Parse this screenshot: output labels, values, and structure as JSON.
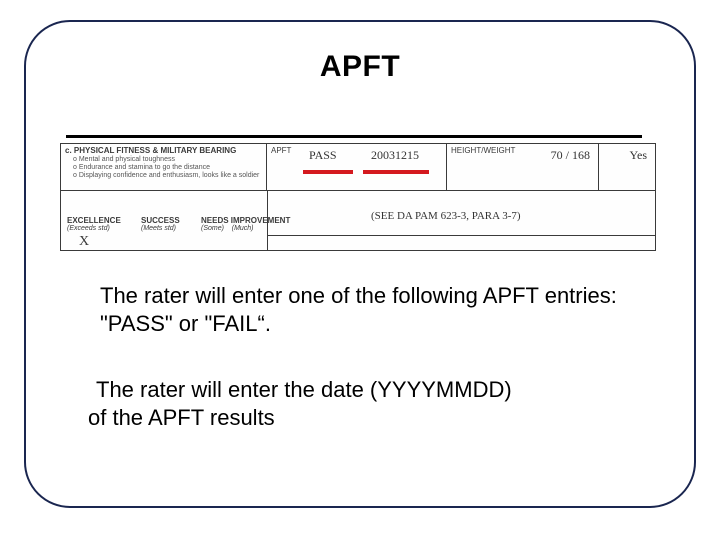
{
  "title": "APFT",
  "form": {
    "section_heading_letter": "c.",
    "section_heading": "PHYSICAL FITNESS & MILITARY BEARING",
    "bullets": [
      "Mental and physical toughness",
      "Endurance and stamina to go the distance",
      "Displaying confidence and enthusiasm, looks like a soldier"
    ],
    "apft_label": "APFT",
    "apft_value": "PASS",
    "apft_date": "20031215",
    "hw_label": "HEIGHT/WEIGHT",
    "hw_value": "70 / 168",
    "compliant_value": "Yes",
    "reference_note": "(SEE DA PAM 623-3, PARA 3-7)",
    "ratings": {
      "excellence_head": "EXCELLENCE",
      "excellence_sub": "(Exceeds std)",
      "success_head": "SUCCESS",
      "success_sub": "(Meets std)",
      "needs_head": "NEEDS IMPROVEMENT",
      "needs_sub_some": "(Some)",
      "needs_sub_much": "(Much)",
      "mark": "X"
    }
  },
  "body": {
    "p1": "The rater will enter one of the following APFT entries: \"PASS\" or \"FAIL“.",
    "p2_a": " The rater will enter the date (YYYYMMDD)",
    "p2_b": "of the APFT results"
  }
}
